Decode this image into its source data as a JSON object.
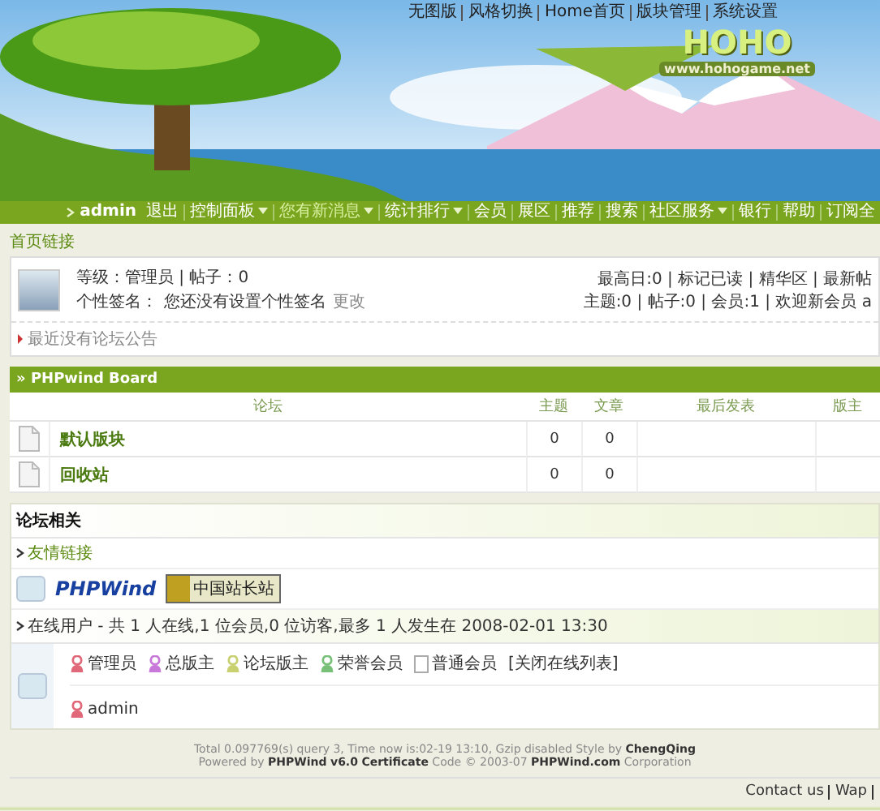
{
  "top_links": [
    "无图版",
    "风格切换",
    "Home首页",
    "版块管理",
    "系统设置"
  ],
  "logo": {
    "title": "HOHO",
    "url": "www.hohogame.net"
  },
  "nav": [
    {
      "label": "admin",
      "kind": "user",
      "dropdown": false
    },
    {
      "label": "退出",
      "kind": "link",
      "dropdown": false
    },
    {
      "label": "控制面板",
      "kind": "link",
      "dropdown": true
    },
    {
      "label": "您有新消息",
      "kind": "alert",
      "dropdown": true
    },
    {
      "label": "统计排行",
      "kind": "link",
      "dropdown": true
    },
    {
      "label": "会员",
      "kind": "link",
      "dropdown": false
    },
    {
      "label": "展区",
      "kind": "link",
      "dropdown": false
    },
    {
      "label": "推荐",
      "kind": "link",
      "dropdown": false
    },
    {
      "label": "搜索",
      "kind": "link",
      "dropdown": false
    },
    {
      "label": "社区服务",
      "kind": "link",
      "dropdown": true
    },
    {
      "label": "银行",
      "kind": "link",
      "dropdown": false
    },
    {
      "label": "帮助",
      "kind": "link",
      "dropdown": false
    },
    {
      "label": "订阅全",
      "kind": "link",
      "dropdown": false
    }
  ],
  "breadcrumb": "首页链接",
  "user": {
    "info": "等级：管理员 | 帖子：0",
    "sig_label": "个性签名：",
    "signature": "您还没有设置个性签名",
    "edit": "更改",
    "stats": [
      "最高日:0 | 标记已读 | 精华区 | 最新帖",
      "主题:0 | 帖子:0 | 会员:1 | 欢迎新会员 a"
    ]
  },
  "notice": "最近没有论坛公告",
  "board": {
    "title": "» PHPwind Board",
    "columns": [
      "论坛",
      "主题",
      "文章",
      "最后发表",
      "版主"
    ],
    "rows": [
      {
        "name": "默认版块",
        "topics": "0",
        "posts": "0"
      },
      {
        "name": "回收站",
        "topics": "0",
        "posts": "0"
      }
    ]
  },
  "related": {
    "title": "论坛相关",
    "links_title": "友情链接",
    "links": [
      {
        "label": "PHPWind",
        "kind": "phpwind"
      },
      {
        "label": "中国站长站",
        "kind": "chinaz"
      }
    ],
    "online": "在线用户 - 共 1 人在线,1 位会员,0 位访客,最多 1 人发生在 2008-02-01 13:30",
    "legend": [
      {
        "label": "管理员",
        "color": "#e06878"
      },
      {
        "label": "总版主",
        "color": "#c878d8"
      },
      {
        "label": "论坛版主",
        "color": "#c8d070"
      },
      {
        "label": "荣誉会员",
        "color": "#78c078"
      },
      {
        "label": "普通会员"
      }
    ],
    "close": "[关闭在线列表]",
    "users": [
      {
        "name": "admin",
        "color": "#e06878"
      }
    ]
  },
  "footer": [
    "Total 0.097769(s) query 3, Time now is:02-19 13:10, Gzip disabled Style by **ChengQing**",
    "Powered by **PHPWind** **v6.0** **Certificate** Code © 2003-07 **PHPWind.com** Corporation"
  ],
  "bottom_links": [
    "Contact us",
    "Wap"
  ]
}
